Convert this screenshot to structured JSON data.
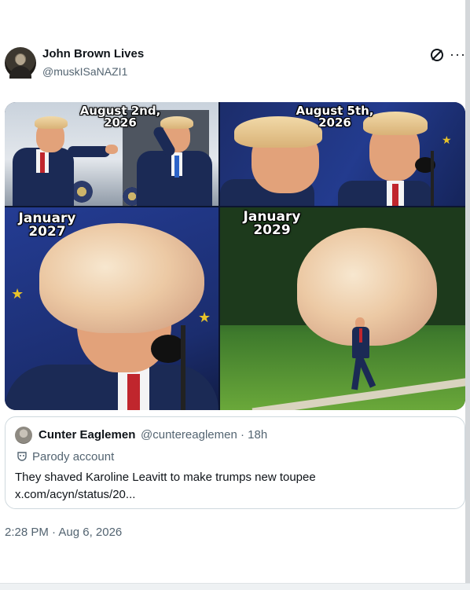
{
  "post": {
    "author_name": "John Brown Lives",
    "author_handle": "@muskISaNAZI1",
    "timestamp": "2:28 PM · Aug 6, 2026"
  },
  "media": {
    "panels": [
      {
        "caption_line1": "August 2nd,",
        "caption_line2": "2026"
      },
      {
        "caption_line1": "August 5th,",
        "caption_line2": "2026"
      },
      {
        "caption_line1": "January",
        "caption_line2": "2027"
      },
      {
        "caption_line1": "January",
        "caption_line2": "2029"
      }
    ]
  },
  "quote": {
    "author_name": "Cunter Eaglemen",
    "author_handle": "@cuntereaglemen · 18h",
    "badge": "Parody account",
    "text": "They shaved Karoline Leavitt to make trumps new toupee",
    "link": "x.com/acyn/status/20..."
  },
  "icons": {
    "grok": "grok-icon",
    "more": "more-options-icon",
    "parody": "parody-mask-icon"
  },
  "colors": {
    "text_primary": "#0f1419",
    "text_secondary": "#536471",
    "border": "#cfd9de"
  }
}
